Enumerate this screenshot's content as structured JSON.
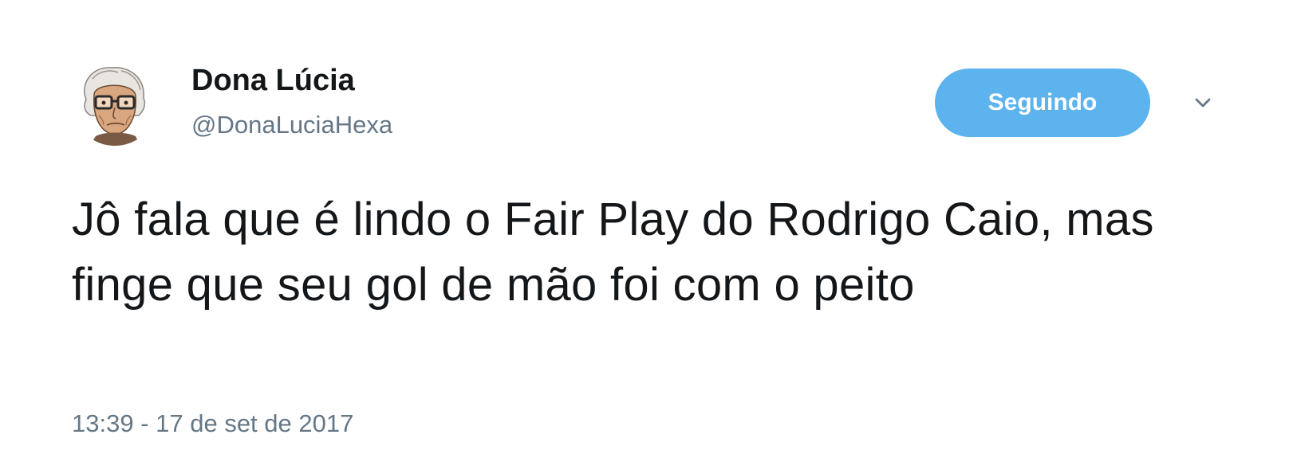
{
  "tweet": {
    "author": {
      "display_name": "Dona Lúcia",
      "handle": "@DonaLuciaHexa",
      "avatar_icon": "elderly-woman-avatar"
    },
    "follow_button": {
      "label": "Seguindo",
      "color": "#5db3ee"
    },
    "menu_icon": "chevron-down-icon",
    "text": "Jô fala que é lindo o Fair Play do Rodrigo Caio, mas finge que seu gol de mão foi com o peito",
    "timestamp": "13:39 - 17 de set de 2017"
  },
  "colors": {
    "text_primary": "#14171a",
    "text_secondary": "#657786",
    "accent": "#5db3ee"
  }
}
